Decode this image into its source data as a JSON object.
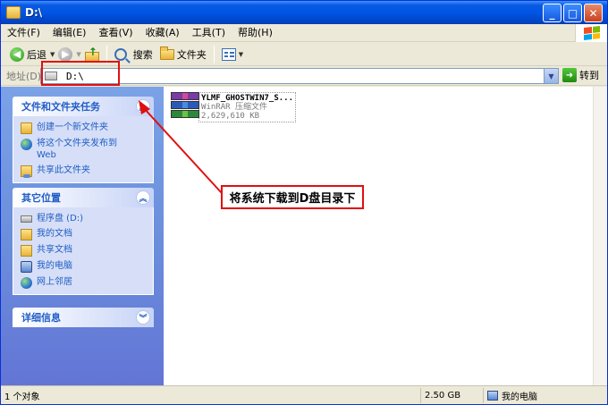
{
  "window": {
    "title": "D:\\"
  },
  "menu": [
    "文件(F)",
    "编辑(E)",
    "查看(V)",
    "收藏(A)",
    "工具(T)",
    "帮助(H)"
  ],
  "toolbar": {
    "back_label": "后退",
    "search_label": "搜索",
    "folders_label": "文件夹"
  },
  "address": {
    "label": "地址(D)",
    "value": "D:\\",
    "go_label": "转到"
  },
  "tasks_panel": {
    "title": "文件和文件夹任务",
    "items": [
      "创建一个新文件夹",
      "将这个文件夹发布到",
      "Web",
      "共享此文件夹"
    ]
  },
  "places_panel": {
    "title": "其它位置",
    "items": [
      "程序盘 (D:)",
      "我的文档",
      "共享文档",
      "我的电脑",
      "网上邻居"
    ]
  },
  "details_panel": {
    "title": "详细信息"
  },
  "file": {
    "name": "YLMF_GHOSTWIN7_S...",
    "type": "WinRAR 压缩文件",
    "size": "2,629,610 KB"
  },
  "annotation": {
    "text": "将系统下载到D盘目录下",
    "color": "#e01010"
  },
  "status": {
    "objects": "1 个对象",
    "size": "2.50 GB",
    "location": "我的电脑"
  },
  "icons": [
    "folder-icon",
    "back-icon",
    "forward-icon",
    "up-folder-icon",
    "search-icon",
    "folders-icon",
    "views-icon",
    "go-icon",
    "winrar-archive-icon",
    "my-computer-icon"
  ]
}
